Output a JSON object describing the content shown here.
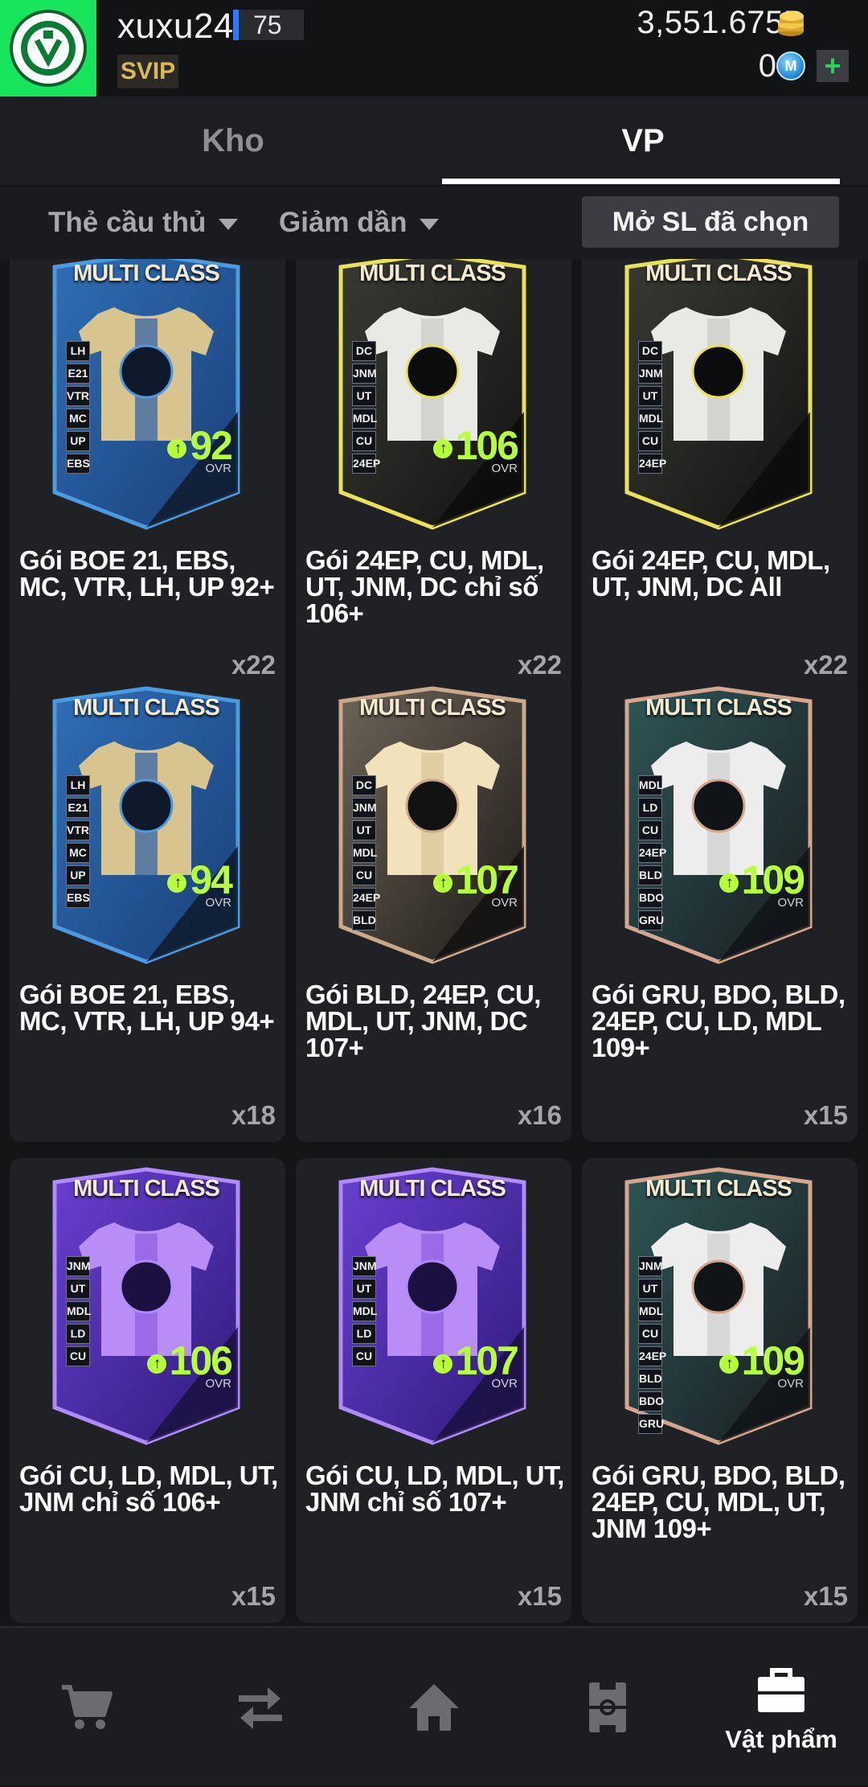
{
  "header": {
    "username": "xuxu24",
    "level": "75",
    "vip_badge": "SVIP",
    "coins": "3,551.675B",
    "mcash": "0",
    "mcash_icon_letter": "M",
    "icons": [
      "club-crest-icon",
      "coin-stack-icon",
      "m-cash-icon",
      "plus-icon"
    ]
  },
  "tabs": [
    {
      "label": "Kho",
      "active": false
    },
    {
      "label": "VP",
      "active": true
    }
  ],
  "filters": {
    "type_label": "Thẻ cầu thủ",
    "sort_label": "Giảm dần",
    "open_selected_label": "Mở SL đã chọn"
  },
  "packs": [
    {
      "card_title": "MULTI CLASS",
      "positions": [
        "LH",
        "E21",
        "VTR",
        "MC",
        "UP",
        "EBS"
      ],
      "ovr": "92",
      "ovr_label": "OVR",
      "name": "Gói BOE 21, EBS, MC, VTR, LH, UP 92+",
      "qty": "x22",
      "theme": "blue"
    },
    {
      "card_title": "MULTI CLASS",
      "positions": [
        "DC",
        "JNM",
        "UT",
        "MDL",
        "CU",
        "24EP"
      ],
      "ovr": "106",
      "ovr_label": "OVR",
      "name": "Gói 24EP, CU, MDL, UT, JNM, DC chỉ số 106+",
      "qty": "x22",
      "theme": "gold"
    },
    {
      "card_title": "MULTI CLASS",
      "positions": [
        "DC",
        "JNM",
        "UT",
        "MDL",
        "CU",
        "24EP"
      ],
      "ovr": "",
      "ovr_label": "",
      "name": "Gói 24EP, CU, MDL, UT, JNM, DC All",
      "qty": "x22",
      "theme": "gold"
    },
    {
      "card_title": "MULTI CLASS",
      "positions": [
        "LH",
        "E21",
        "VTR",
        "MC",
        "UP",
        "EBS"
      ],
      "ovr": "94",
      "ovr_label": "OVR",
      "name": "Gói BOE 21, EBS, MC, VTR, LH, UP 94+",
      "qty": "x18",
      "theme": "blue"
    },
    {
      "card_title": "MULTI CLASS",
      "positions": [
        "DC",
        "JNM",
        "UT",
        "MDL",
        "CU",
        "24EP",
        "BLD"
      ],
      "ovr": "107",
      "ovr_label": "OVR",
      "name": "Gói BLD, 24EP, CU, MDL, UT, JNM, DC 107+",
      "qty": "x16",
      "theme": "bronze"
    },
    {
      "card_title": "MULTI CLASS",
      "positions": [
        "MDL",
        "LD",
        "CU",
        "24EP",
        "BLD",
        "BDO",
        "GRU"
      ],
      "ovr": "109",
      "ovr_label": "OVR",
      "name": "Gói GRU, BDO, BLD, 24EP, CU, LD, MDL 109+",
      "qty": "x15",
      "theme": "teal"
    },
    {
      "card_title": "MULTI CLASS",
      "positions": [
        "JNM",
        "UT",
        "MDL",
        "LD",
        "CU"
      ],
      "ovr": "106",
      "ovr_label": "OVR",
      "name": "Gói CU, LD, MDL, UT, JNM chỉ số 106+",
      "qty": "x15",
      "theme": "purple"
    },
    {
      "card_title": "MULTI CLASS",
      "positions": [
        "JNM",
        "UT",
        "MDL",
        "LD",
        "CU"
      ],
      "ovr": "107",
      "ovr_label": "OVR",
      "name": "Gói CU, LD, MDL, UT, JNM chỉ số 107+",
      "qty": "x15",
      "theme": "purple"
    },
    {
      "card_title": "MULTI CLASS",
      "positions": [
        "JNM",
        "UT",
        "MDL",
        "CU",
        "24EP",
        "BLD",
        "BDO",
        "GRU"
      ],
      "ovr": "109",
      "ovr_label": "OVR",
      "name": "Gói GRU, BDO, BLD, 24EP, CU, MDL, UT, JNM 109+",
      "qty": "x15",
      "theme": "teal"
    }
  ],
  "bottom_nav": [
    {
      "icon": "shop-cart-icon",
      "label": "",
      "active": false
    },
    {
      "icon": "transfer-icon",
      "label": "",
      "active": false
    },
    {
      "icon": "home-icon",
      "label": "",
      "active": false
    },
    {
      "icon": "squad-field-icon",
      "label": "",
      "active": false
    },
    {
      "icon": "bag-icon",
      "label": "Vật phẩm",
      "active": true
    }
  ],
  "colors": {
    "background": "#141517",
    "card": "#202124",
    "accent_green": "#b7ff3a",
    "tab_indicator": "#ffffff",
    "level_bar": "#2d7cf6",
    "club_badge_bg": "#17e65d"
  }
}
